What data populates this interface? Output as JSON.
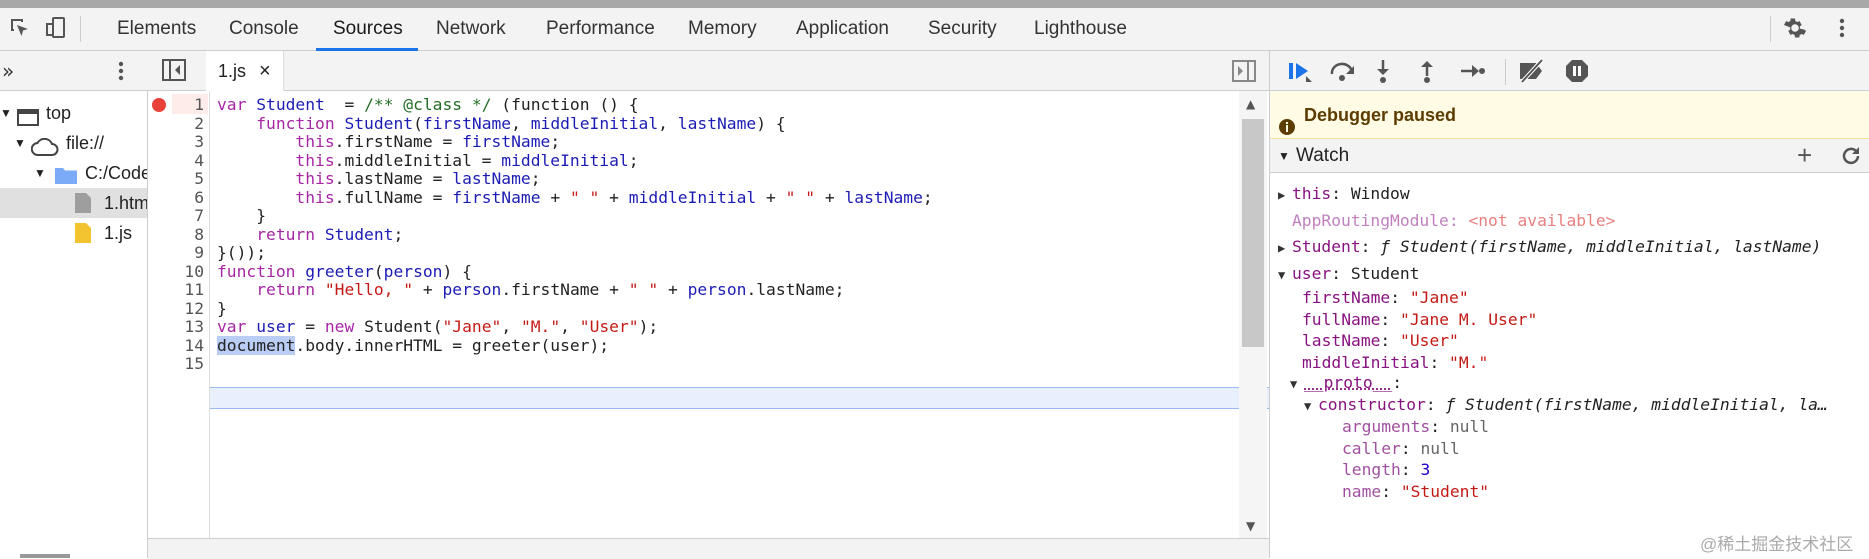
{
  "tabs": [
    {
      "label": "Elements"
    },
    {
      "label": "Console"
    },
    {
      "label": "Sources",
      "active": true
    },
    {
      "label": "Network"
    },
    {
      "label": "Performance"
    },
    {
      "label": "Memory"
    },
    {
      "label": "Application"
    },
    {
      "label": "Security"
    },
    {
      "label": "Lighthouse"
    }
  ],
  "navigator": {
    "items": [
      {
        "label": "top"
      },
      {
        "label": "file://"
      },
      {
        "label": "C:/Code"
      },
      {
        "label": "1.htm"
      },
      {
        "label": "1.js"
      }
    ]
  },
  "editor": {
    "file_tab": "1.js",
    "close_glyph": "×",
    "breakpoint_line": "1",
    "line_numbers": [
      "1",
      "2",
      "3",
      "4",
      "5",
      "6",
      "7",
      "8",
      "9",
      "10",
      "11",
      "12",
      "13",
      "14",
      "15"
    ]
  },
  "debugger": {
    "paused_message": "Debugger paused",
    "watch_title": "Watch",
    "watch": {
      "this_name": "this",
      "this_value": "Window",
      "approuting_name": "AppRoutingModule",
      "approuting_value": "<not available>",
      "student_name": "Student",
      "student_value": "ƒ Student(firstName, middleInitial, lastName)",
      "user_name": "user",
      "user_value": "Student",
      "props": [
        {
          "name": "firstName",
          "value": "\"Jane\""
        },
        {
          "name": "fullName",
          "value": "\"Jane M. User\""
        },
        {
          "name": "lastName",
          "value": "\"User\""
        },
        {
          "name": "middleInitial",
          "value": "\"M.\""
        }
      ],
      "proto_name": "__proto__",
      "ctor_name": "constructor",
      "ctor_value": "ƒ Student(firstName, middleInitial, la…",
      "ctor_props": [
        {
          "name": "arguments",
          "value": "null"
        },
        {
          "name": "caller",
          "value": "null"
        },
        {
          "name": "length",
          "value": "3"
        },
        {
          "name": "name",
          "value": "\"Student\""
        }
      ]
    }
  },
  "watermark": "@稀土掘金技术社区",
  "colors": {
    "accent": "#1a73e8",
    "breakpoint": "#e8413a",
    "paused_bg": "#fffbe5"
  }
}
